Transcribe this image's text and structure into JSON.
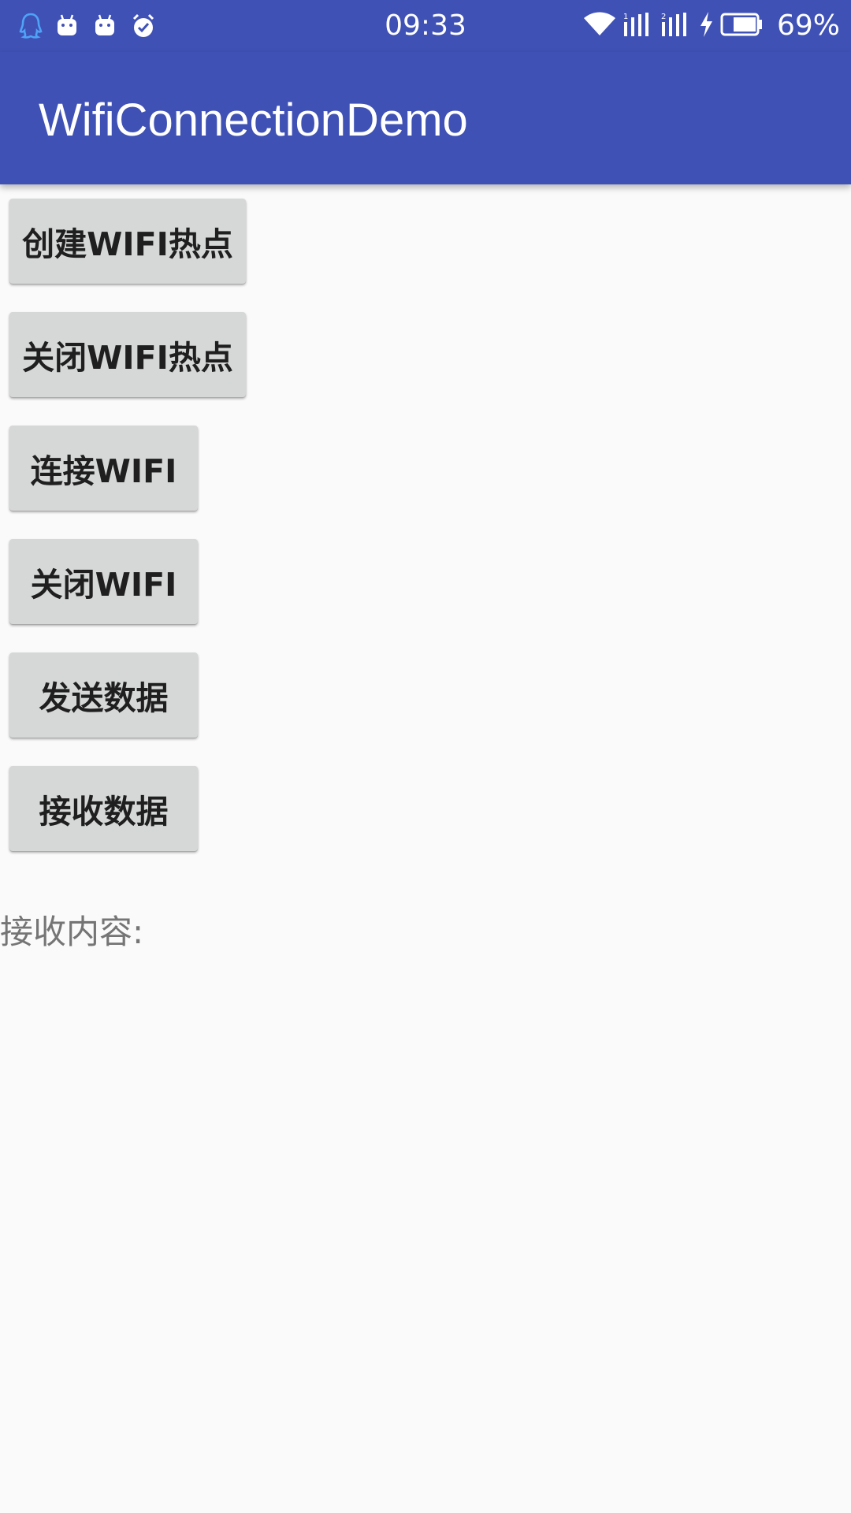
{
  "status_bar": {
    "time": "09:33",
    "battery_percent": "69%",
    "left_icons": [
      "qq-icon",
      "android-icon",
      "android-icon",
      "alarm-icon"
    ],
    "right_icons": [
      "wifi-icon",
      "signal-1-icon",
      "signal-2-icon",
      "charging-icon",
      "battery-icon"
    ],
    "bar_color": "#3F51B5"
  },
  "app_bar": {
    "title": "WifiConnectionDemo",
    "color": "#3F51B5"
  },
  "buttons": [
    {
      "label": "创建WIFI热点"
    },
    {
      "label": "关闭WIFI热点"
    },
    {
      "label": "连接WIFI"
    },
    {
      "label": "关闭WIFI"
    },
    {
      "label": "发送数据"
    },
    {
      "label": "接收数据"
    }
  ],
  "received": {
    "label": "接收内容:"
  }
}
